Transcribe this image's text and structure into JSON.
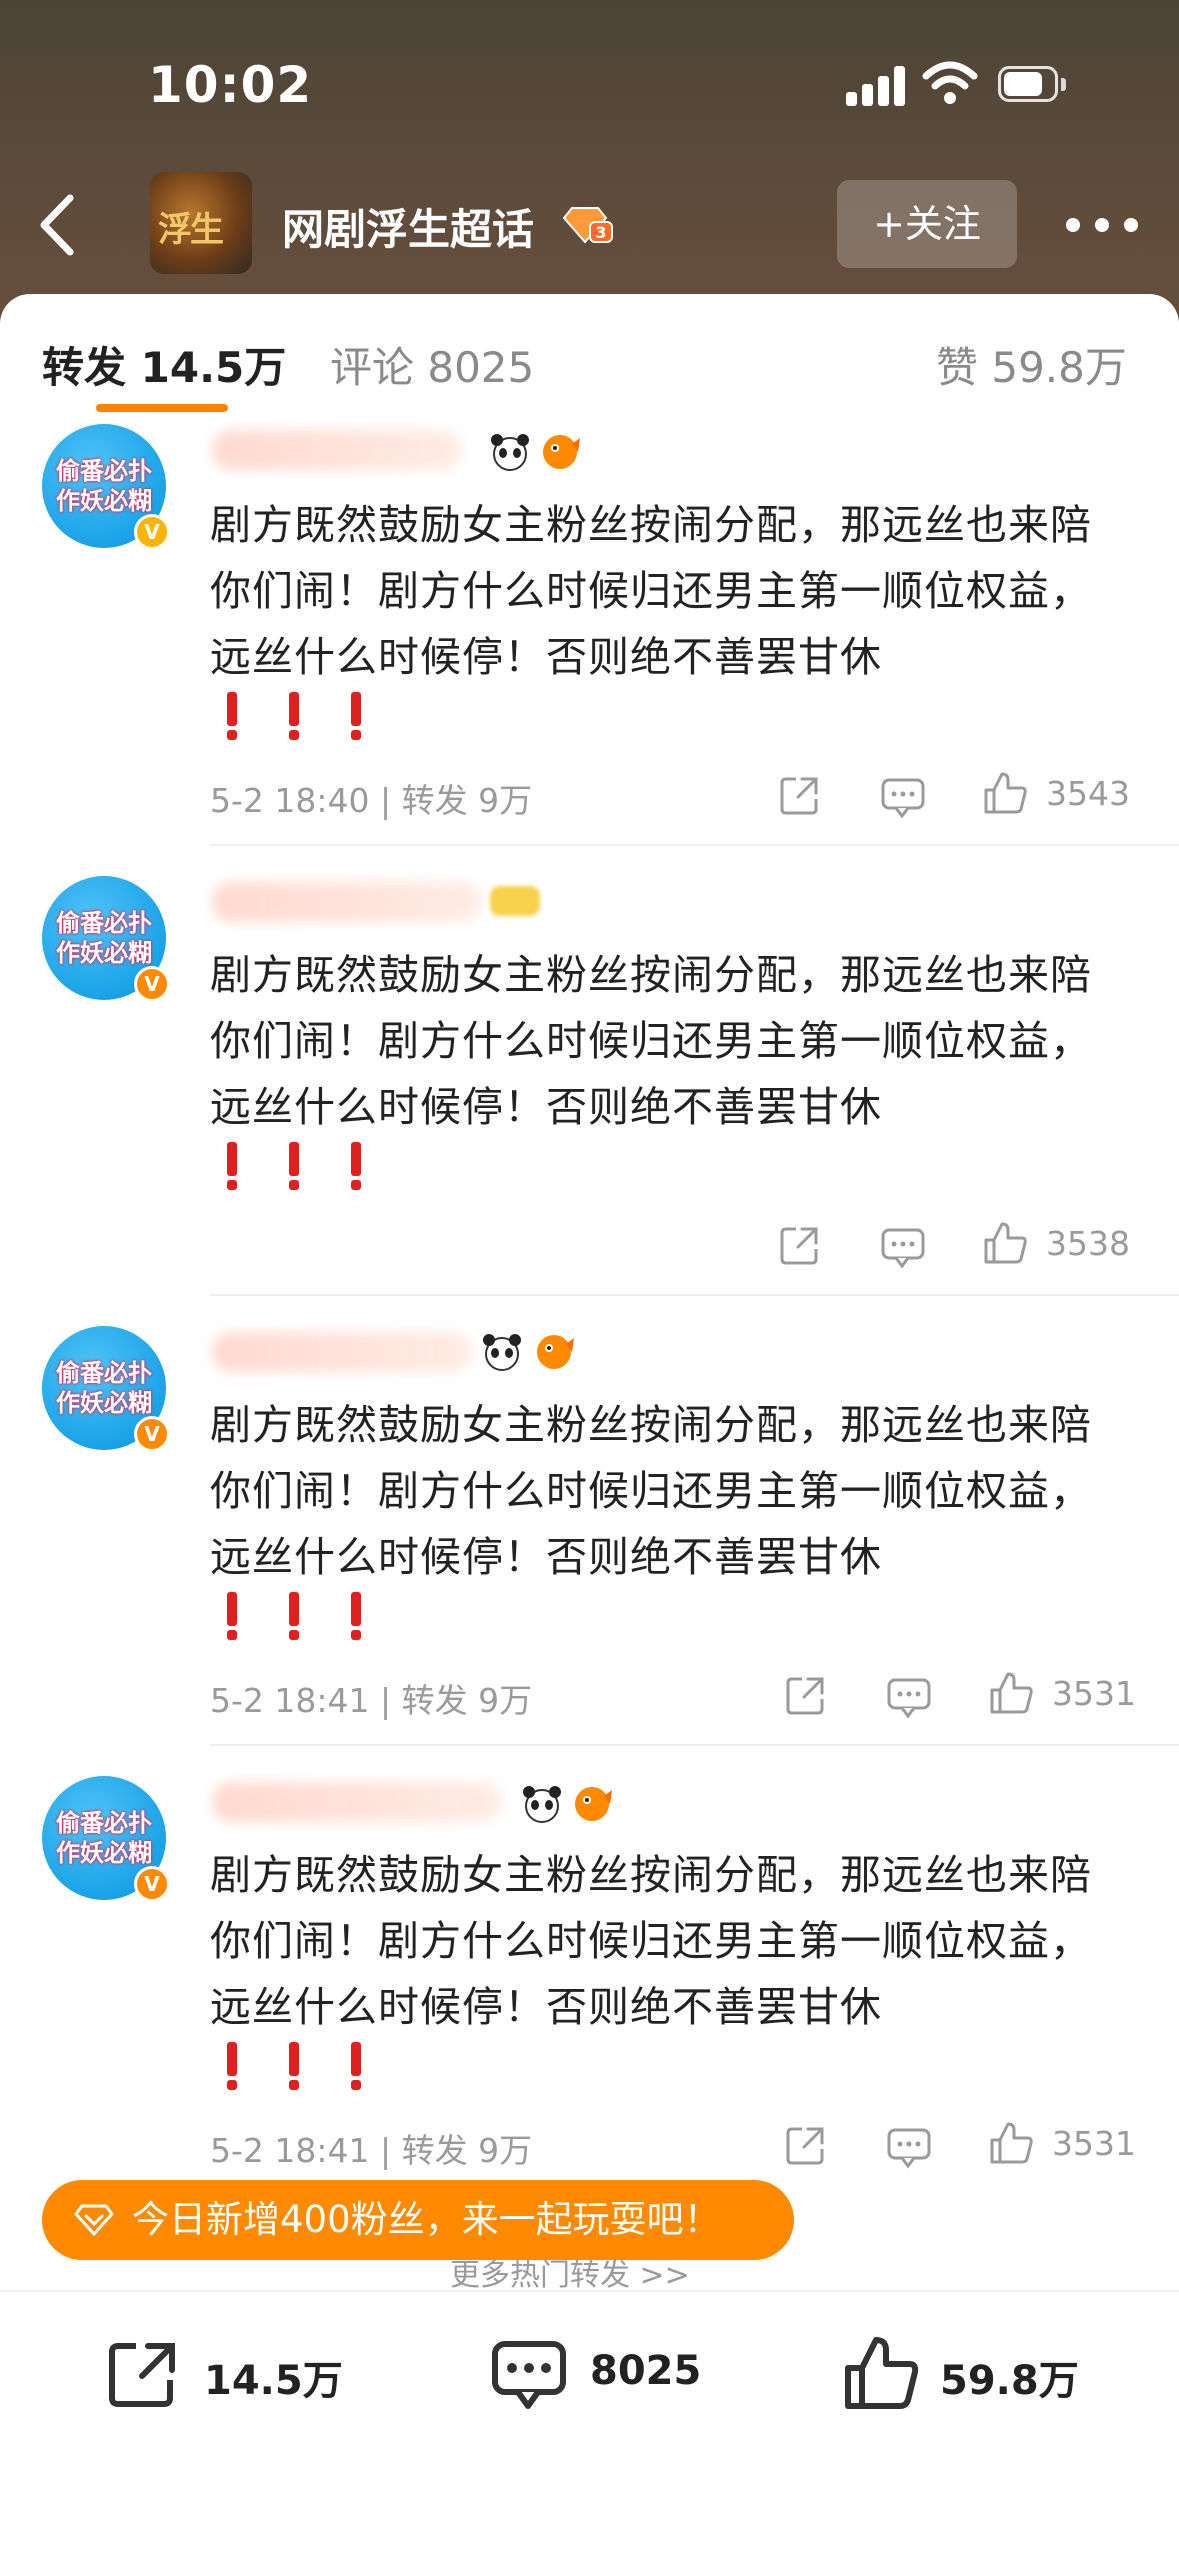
{
  "status_bar": {
    "time": "10:02"
  },
  "header": {
    "thumb_text": "浮生",
    "title": "网剧浮生超话",
    "follow_label": "+关注"
  },
  "tabs": {
    "repost": "转发 14.5万",
    "comment": "评论 8025",
    "like": "赞 59.8万"
  },
  "reposts": [
    {
      "avatar_text": "偷番必扑作妖必糊",
      "text": "剧方既然鼓励女主粉丝按闹分配，那远丝也来陪你们闹！剧方什么时候归还男主第一顺位权益，远丝什么时候停！否则绝不善罢甘休",
      "meta": "5-2 18:40 | 转发 9万",
      "likes": "3543"
    },
    {
      "avatar_text": "偷番必扑作妖必糊",
      "text": "剧方既然鼓励女主粉丝按闹分配，那远丝也来陪你们闹！剧方什么时候归还男主第一顺位权益，远丝什么时候停！否则绝不善罢甘休",
      "meta": "",
      "likes": "3538"
    },
    {
      "avatar_text": "偷番必扑作妖必糊",
      "text": "剧方既然鼓励女主粉丝按闹分配，那远丝也来陪你们闹！剧方什么时候归还男主第一顺位权益，远丝什么时候停！否则绝不善罢甘休",
      "meta": "5-2 18:41 | 转发 9万",
      "likes": "3531"
    },
    {
      "avatar_text": "偷番必扑作妖必糊",
      "text": "剧方既然鼓励女主粉丝按闹分配，那远丝也来陪你们闹！剧方什么时候归还男主第一顺位权益，远丝什么时候停！否则绝不善罢甘休",
      "meta": "5-2 18:41 | 转发 9万",
      "likes": "3531"
    }
  ],
  "more_reposts": "更多热门转发 >>",
  "banner_text": "今日新增400粉丝，来一起玩耍吧！",
  "bottom_bar": {
    "repost": "14.5万",
    "comment": "8025",
    "like": "59.8万"
  },
  "icons": [
    "back-icon",
    "more-icon",
    "share-icon",
    "comment-icon",
    "like-icon",
    "verified-icon",
    "panda-icon",
    "fish-icon",
    "diamond-icon"
  ],
  "colors": {
    "accent": "#ff8200",
    "banner": "#ff8a00",
    "verified": "#ff8a00",
    "bang": "#e0201e"
  }
}
